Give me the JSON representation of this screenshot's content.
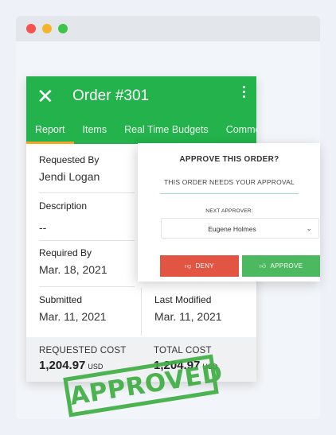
{
  "order": {
    "title": "Order #301",
    "tabs": [
      "Report",
      "Items",
      "Real Time Budgets",
      "Comments"
    ],
    "fields": {
      "requested_by": {
        "label": "Requested By",
        "value": "Jendi Logan"
      },
      "description": {
        "label": "Description",
        "value": "--"
      },
      "required_by": {
        "label": "Required By",
        "value": "Mar. 18, 2021"
      },
      "submitted": {
        "label": "Submitted",
        "value": "Mar. 11, 2021"
      },
      "last_modified": {
        "label": "Last Modified",
        "value": "Mar. 11, 2021"
      }
    },
    "requested_cost": {
      "label": "REQUESTED COST",
      "value": "1,204.97",
      "currency": "USD"
    },
    "total_cost": {
      "label": "TOTAL COST",
      "value": "1,204.97",
      "currency": "USD"
    }
  },
  "approval": {
    "title": "APPROVE THIS ORDER?",
    "subtitle": "THIS ORDER NEEDS YOUR APPROVAL",
    "next_approver_label": "NEXT APPROVER:",
    "next_approver": "Eugene Holmes",
    "deny_label": "DENY",
    "approve_label": "APPROVE"
  },
  "stamp": {
    "text": "APPROVED"
  },
  "colors": {
    "header": "#23b24b",
    "deny": "#e25542",
    "approve": "#4cb860",
    "tab_indicator": "#f5a623"
  }
}
